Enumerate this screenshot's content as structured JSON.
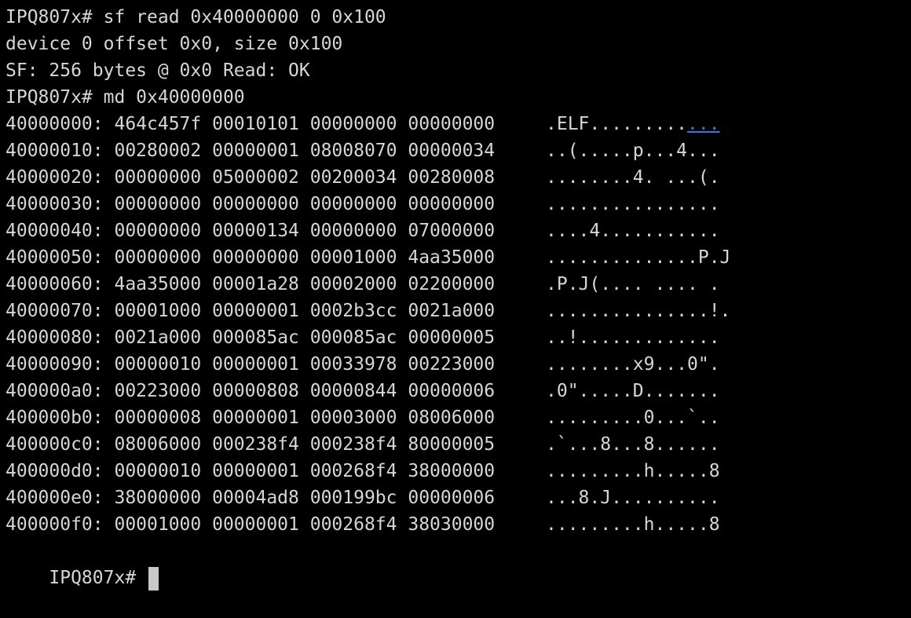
{
  "terminal": {
    "lines": [
      "IPQ807x# sf read 0x40000000 0 0x100",
      "device 0 offset 0x0, size 0x100",
      "SF: 256 bytes @ 0x0 Read: OK",
      "IPQ807x# md 0x40000000"
    ],
    "dump": [
      {
        "hex": "40000000: 464c457f 00010101 00000000 00000000",
        "ascii": ".ELF.........",
        "ascii_link": "..."
      },
      {
        "hex": "40000010: 00280002 00000001 08008070 00000034",
        "ascii": "..(.....p...4..."
      },
      {
        "hex": "40000020: 00000000 05000002 00200034 00280008",
        "ascii": "........4. ...(."
      },
      {
        "hex": "40000030: 00000000 00000000 00000000 00000000",
        "ascii": "................"
      },
      {
        "hex": "40000040: 00000000 00000134 00000000 07000000",
        "ascii": "....4..........."
      },
      {
        "hex": "40000050: 00000000 00000000 00001000 4aa35000",
        "ascii": "..............P.J"
      },
      {
        "hex": "40000060: 4aa35000 00001a28 00002000 02200000",
        "ascii": ".P.J(.... .... ."
      },
      {
        "hex": "40000070: 00001000 00000001 0002b3cc 0021a000",
        "ascii": "...............!."
      },
      {
        "hex": "40000080: 0021a000 000085ac 000085ac 00000005",
        "ascii": "..!............."
      },
      {
        "hex": "40000090: 00000010 00000001 00033978 00223000",
        "ascii": "........x9...0\"."
      },
      {
        "hex": "400000a0: 00223000 00000808 00000844 00000006",
        "ascii": ".0\".....D......."
      },
      {
        "hex": "400000b0: 00000008 00000001 00003000 08006000",
        "ascii": ".........0...`.."
      },
      {
        "hex": "400000c0: 08006000 000238f4 000238f4 80000005",
        "ascii": ".`...8...8......"
      },
      {
        "hex": "400000d0: 00000010 00000001 000268f4 38000000",
        "ascii": ".........h.....8"
      },
      {
        "hex": "400000e0: 38000000 00004ad8 000199bc 00000006",
        "ascii": "...8.J.........."
      },
      {
        "hex": "400000f0: 00001000 00000001 000268f4 38030000",
        "ascii": ".........h.....8"
      }
    ],
    "prompt": "IPQ807x#"
  },
  "colors": {
    "background": "#000000",
    "foreground": "#d6d6d6",
    "link": "#3a78d8",
    "cursor": "#c8c8c8"
  }
}
